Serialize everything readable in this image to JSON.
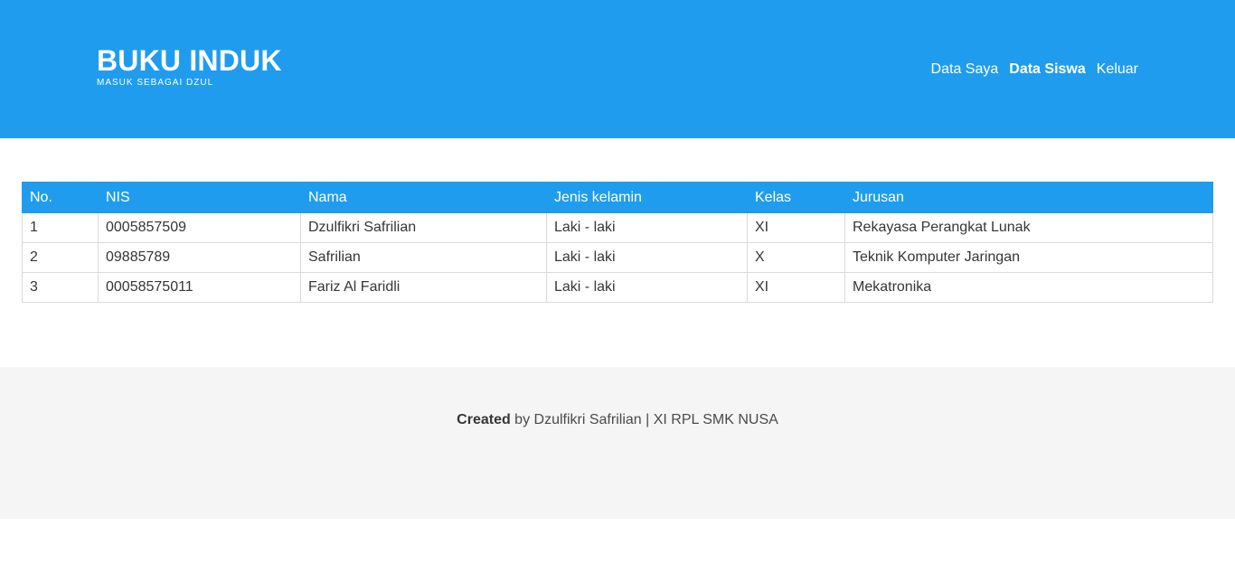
{
  "header": {
    "title": "BUKU INDUK",
    "subtitle": "MASUK SEBAGAI DZUL",
    "nav": [
      {
        "label": "Data Saya",
        "active": false
      },
      {
        "label": "Data Siswa",
        "active": true
      },
      {
        "label": "Keluar",
        "active": false
      }
    ],
    "bg_color": "#209cee"
  },
  "table": {
    "columns": [
      "No.",
      "NIS",
      "Nama",
      "Jenis kelamin",
      "Kelas",
      "Jurusan"
    ],
    "rows": [
      [
        "1",
        "0005857509",
        "Dzulfikri Safrilian",
        "Laki - laki",
        "XI",
        "Rekayasa Perangkat Lunak"
      ],
      [
        "2",
        "09885789",
        "Safrilian",
        "Laki - laki",
        "X",
        "Teknik Komputer Jaringan"
      ],
      [
        "3",
        "00058575011",
        "Fariz Al Faridli",
        "Laki - laki",
        "XI",
        "Mekatronika"
      ]
    ]
  },
  "footer": {
    "strong": "Created",
    "text": " by Dzulfikri Safrilian | XI RPL SMK NUSA"
  }
}
